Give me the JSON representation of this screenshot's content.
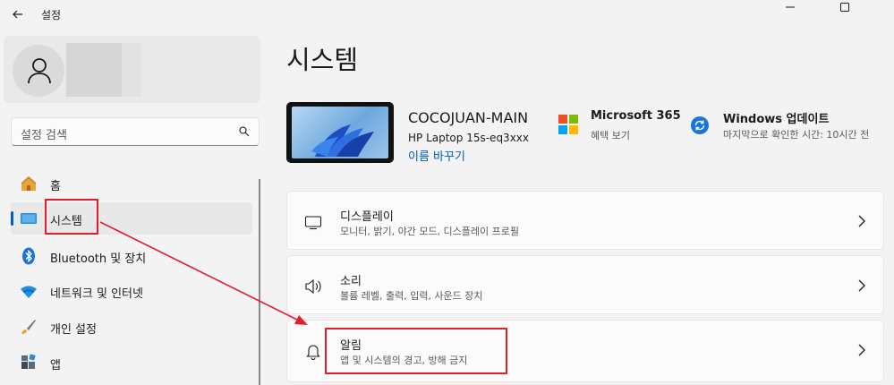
{
  "window": {
    "title": "설정"
  },
  "sidebar": {
    "search_placeholder": "설정 검색",
    "items": [
      {
        "label": "홈",
        "icon": "home-icon"
      },
      {
        "label": "시스템",
        "icon": "system-icon",
        "selected": true
      },
      {
        "label": "Bluetooth 및 장치",
        "icon": "bluetooth-icon"
      },
      {
        "label": "네트워크 및 인터넷",
        "icon": "wifi-icon"
      },
      {
        "label": "개인 설정",
        "icon": "brush-icon"
      },
      {
        "label": "앱",
        "icon": "apps-icon"
      }
    ]
  },
  "main": {
    "title": "시스템",
    "device": {
      "name": "COCOJUAN-MAIN",
      "model": "HP Laptop 15s-eq3xxx",
      "rename_label": "이름 바꾸기"
    },
    "ms365": {
      "title": "Microsoft 365",
      "subtitle": "혜택 보기"
    },
    "windows_update": {
      "title": "Windows 업데이트",
      "subtitle": "마지막으로 확인한 시간: 10시간 전"
    },
    "cards": [
      {
        "title": "디스플레이",
        "subtitle": "모니터, 밝기, 야간 모드, 디스플레이 프로필",
        "icon": "monitor-icon"
      },
      {
        "title": "소리",
        "subtitle": "볼륨 레벨, 출력, 입력, 사운드 장치",
        "icon": "speaker-icon"
      },
      {
        "title": "알림",
        "subtitle": "앱 및 시스템의 경고, 방해 금지",
        "icon": "bell-icon"
      }
    ]
  },
  "colors": {
    "accent": "#005fb8",
    "annotation": "#e01f2e"
  }
}
